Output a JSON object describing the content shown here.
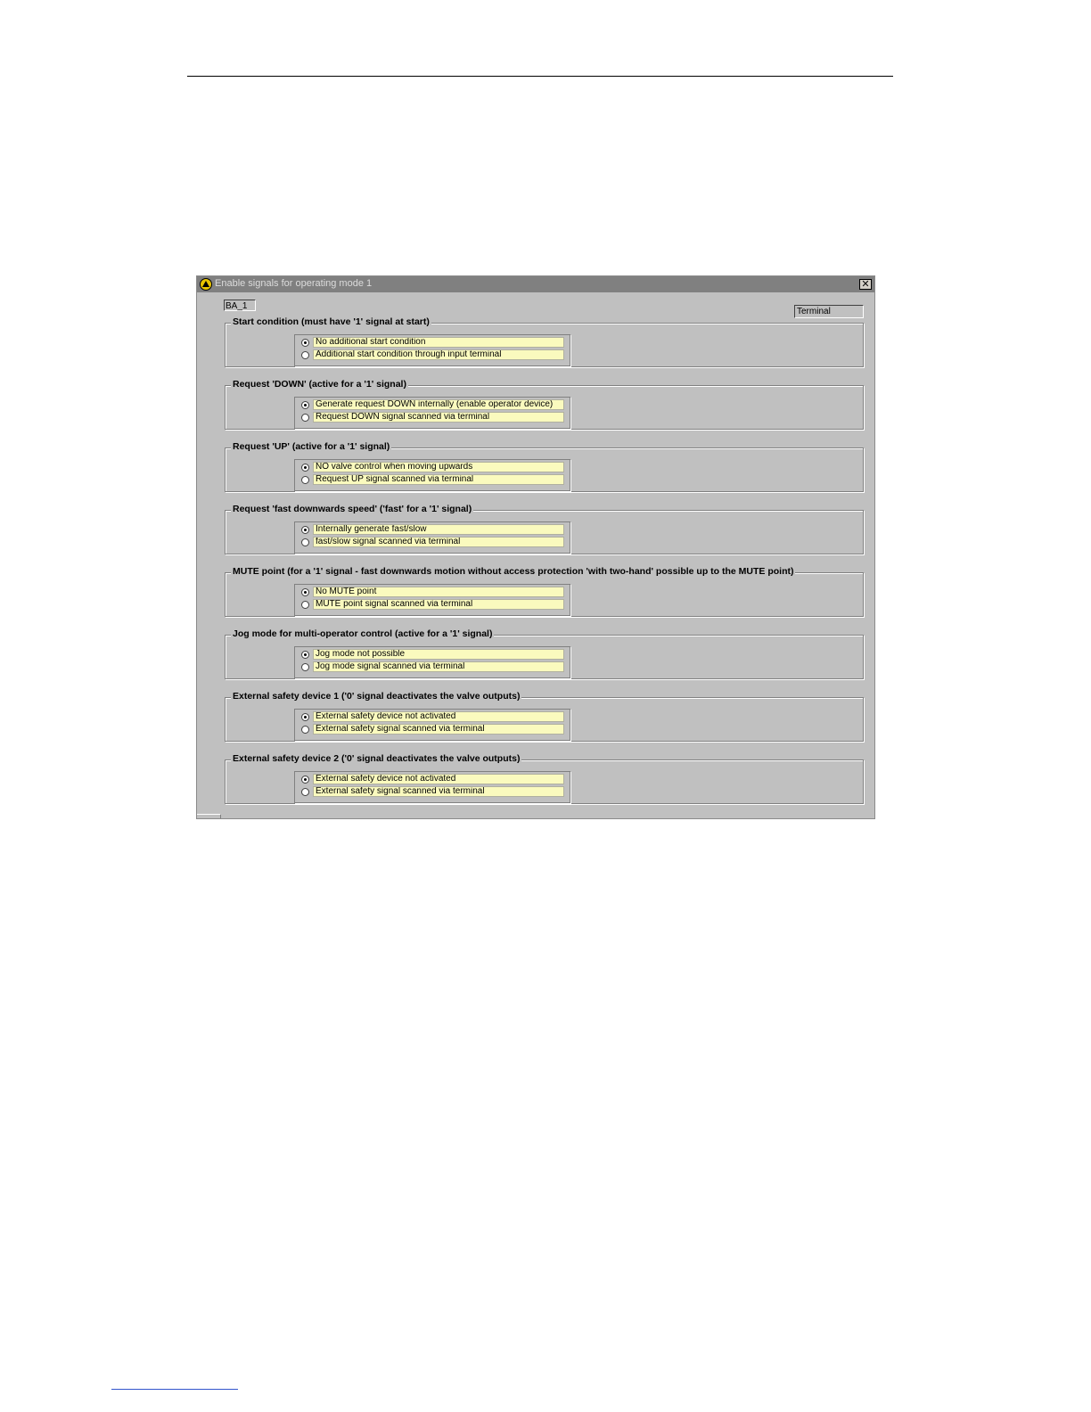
{
  "window": {
    "title": "Enable signals for operating mode 1",
    "close_glyph": "✕",
    "icon": "app-bell-icon"
  },
  "mode_field": "BA_1",
  "terminal_field": "Terminal",
  "groups": [
    {
      "title": "Start condition (must have '1' signal at start)",
      "options": [
        "No additional start condition",
        "Additional start condition through input terminal"
      ],
      "selected": 0
    },
    {
      "title": "Request 'DOWN' (active for a '1' signal)",
      "options": [
        "Generate request DOWN internally (enable operator device)",
        "Request DOWN signal scanned via terminal"
      ],
      "selected": 0
    },
    {
      "title": "Request 'UP' (active for a '1' signal)",
      "options": [
        "NO valve control when moving upwards",
        "Request UP signal scanned via terminal"
      ],
      "selected": 0
    },
    {
      "title": "Request 'fast downwards speed' ('fast' for a '1' signal)",
      "options": [
        "Internally generate fast/slow",
        "fast/slow signal scanned via terminal"
      ],
      "selected": 0
    },
    {
      "title": "MUTE point (for a '1' signal - fast downwards motion without access protection 'with two-hand' possible up to the MUTE point)",
      "options": [
        "No MUTE point",
        "MUTE point signal scanned via terminal"
      ],
      "selected": 0
    },
    {
      "title": "Jog mode for multi-operator control (active for a '1' signal)",
      "options": [
        "Jog mode not possible",
        "Jog mode signal scanned via terminal"
      ],
      "selected": 0
    },
    {
      "title": "External safety device 1 ('0' signal deactivates the valve outputs)",
      "options": [
        "External safety device not activated",
        "External safety signal scanned via terminal"
      ],
      "selected": 0
    },
    {
      "title": "External safety device 2 ('0' signal deactivates the valve outputs)",
      "options": [
        "External safety device not activated",
        "External safety signal scanned via terminal"
      ],
      "selected": 0
    }
  ]
}
